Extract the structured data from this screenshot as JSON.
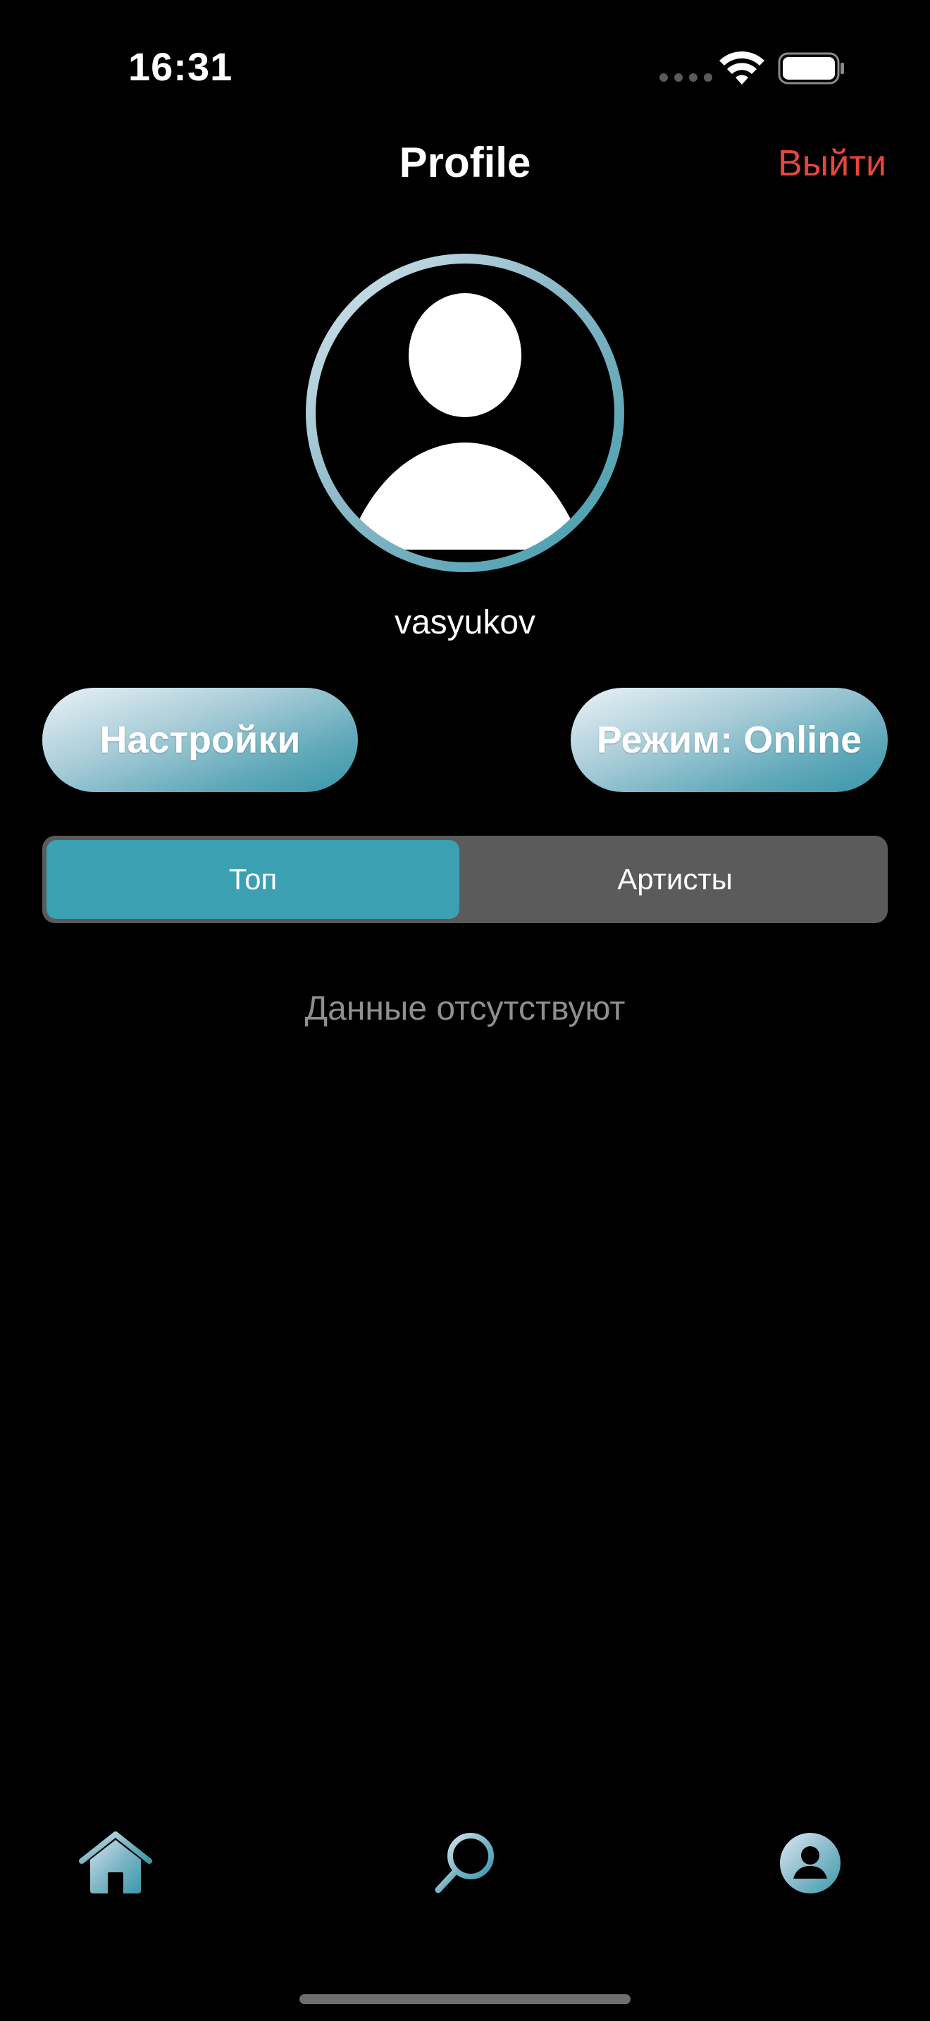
{
  "status_bar": {
    "time": "16:31",
    "icons": [
      "cellular-signal-icon",
      "wifi-icon",
      "battery-icon"
    ]
  },
  "nav": {
    "title": "Profile",
    "logout_label": "Выйти"
  },
  "profile": {
    "avatar_icon": "person-icon",
    "username": "vasyukov"
  },
  "actions": {
    "settings_label": "Настройки",
    "mode_label": "Режим: Online"
  },
  "segments": {
    "items": [
      {
        "label": "Топ",
        "selected": true
      },
      {
        "label": "Артисты",
        "selected": false
      }
    ]
  },
  "content": {
    "empty_message": "Данные отсутствуют"
  },
  "tab_bar": {
    "items": [
      {
        "icon": "home-icon",
        "selected": false
      },
      {
        "icon": "search-icon",
        "selected": false
      },
      {
        "icon": "profile-icon",
        "selected": true
      }
    ]
  },
  "colors": {
    "background": "#000000",
    "accent": "#3ba0b1",
    "destructive": "#e8463c",
    "segment_background": "#5b5b5b",
    "muted_text": "#8e8e8e"
  }
}
